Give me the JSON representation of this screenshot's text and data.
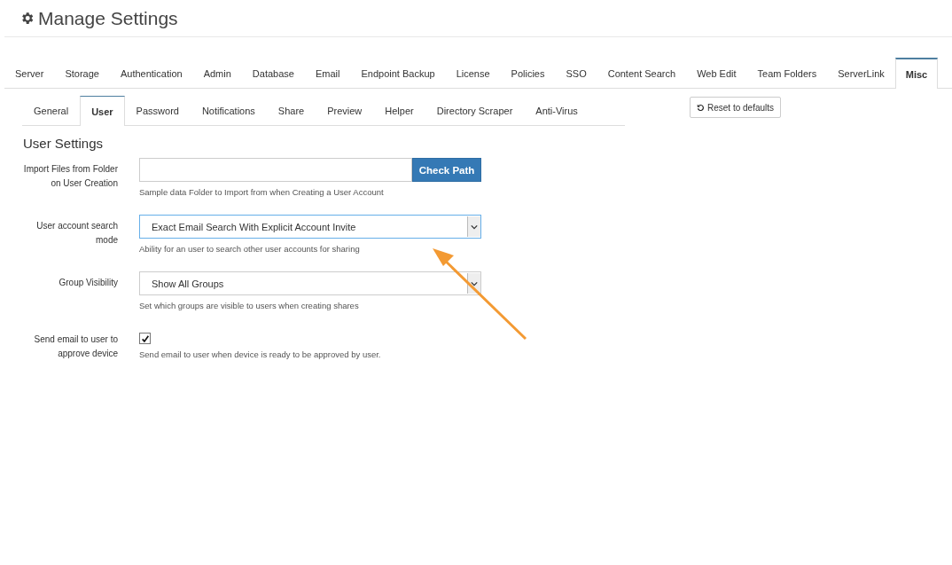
{
  "page": {
    "title": "Manage Settings"
  },
  "tabs": [
    {
      "label": "Server",
      "selected": false
    },
    {
      "label": "Storage",
      "selected": false
    },
    {
      "label": "Authentication",
      "selected": false
    },
    {
      "label": "Admin",
      "selected": false
    },
    {
      "label": "Database",
      "selected": false
    },
    {
      "label": "Email",
      "selected": false
    },
    {
      "label": "Endpoint Backup",
      "selected": false
    },
    {
      "label": "License",
      "selected": false
    },
    {
      "label": "Policies",
      "selected": false
    },
    {
      "label": "SSO",
      "selected": false
    },
    {
      "label": "Content Search",
      "selected": false
    },
    {
      "label": "Web Edit",
      "selected": false
    },
    {
      "label": "Team Folders",
      "selected": false
    },
    {
      "label": "ServerLink",
      "selected": false
    },
    {
      "label": "Misc",
      "selected": true
    }
  ],
  "subtabs": [
    {
      "label": "General",
      "selected": false
    },
    {
      "label": "User",
      "selected": true
    },
    {
      "label": "Password",
      "selected": false
    },
    {
      "label": "Notifications",
      "selected": false
    },
    {
      "label": "Share",
      "selected": false
    },
    {
      "label": "Preview",
      "selected": false
    },
    {
      "label": "Helper",
      "selected": false
    },
    {
      "label": "Directory Scraper",
      "selected": false
    },
    {
      "label": "Anti-Virus",
      "selected": false
    }
  ],
  "reset_button": "Reset to defaults",
  "section_title": "User Settings",
  "settings": [
    {
      "kind": "path",
      "label": "Import Files from Folder on User Creation",
      "button": "Check Path",
      "help": "Sample data Folder to Import from when Creating a User Account"
    },
    {
      "kind": "select",
      "label": "User account search mode",
      "value": "Exact Email Search With Explicit Account Invite",
      "focused": true,
      "help": "Ability for an user to search other user accounts for sharing"
    },
    {
      "kind": "select",
      "label": "Group Visibility",
      "value": "Show All Groups",
      "focused": false,
      "help": "Set which groups are visible to users when creating shares"
    },
    {
      "kind": "checkbox",
      "label": "Send email to user to approve device",
      "checked": true,
      "help": "Send email to user when device is ready to be approved by user."
    }
  ]
}
